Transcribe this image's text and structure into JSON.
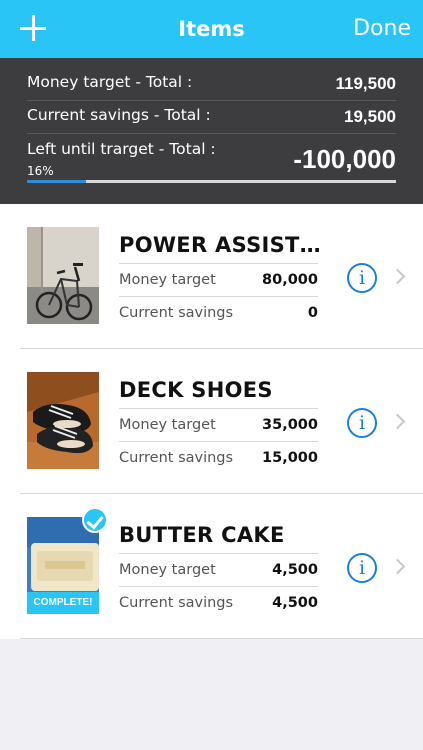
{
  "nav": {
    "title": "Items",
    "done_label": "Done"
  },
  "summary": {
    "money_target_label": "Money target - Total :",
    "money_target_value": "119,500",
    "current_savings_label": "Current savings - Total :",
    "current_savings_value": "19,500",
    "left_label": "Left until trarget - Total :",
    "left_value": "-100,000",
    "percent_text": "16%",
    "progress_fraction": 0.16
  },
  "items": [
    {
      "name": "POWER ASSIST…",
      "target_label": "Money target",
      "target_value": "80,000",
      "savings_label": "Current savings",
      "savings_value": "0",
      "thumb": "bicycle photo"
    },
    {
      "name": "DECK SHOES",
      "target_label": "Money target",
      "target_value": "35,000",
      "savings_label": "Current savings",
      "savings_value": "15,000",
      "thumb": "shoes photo"
    },
    {
      "name": "BUTTER CAKE",
      "target_label": "Money target",
      "target_value": "4,500",
      "savings_label": "Current savings",
      "savings_value": "4,500",
      "thumb": "cake photo",
      "complete_label": "COMPLETE!"
    }
  ],
  "colors": {
    "accent": "#29c5f6",
    "summary_bg": "#3d3d3f",
    "info_blue": "#1a7fe0"
  }
}
